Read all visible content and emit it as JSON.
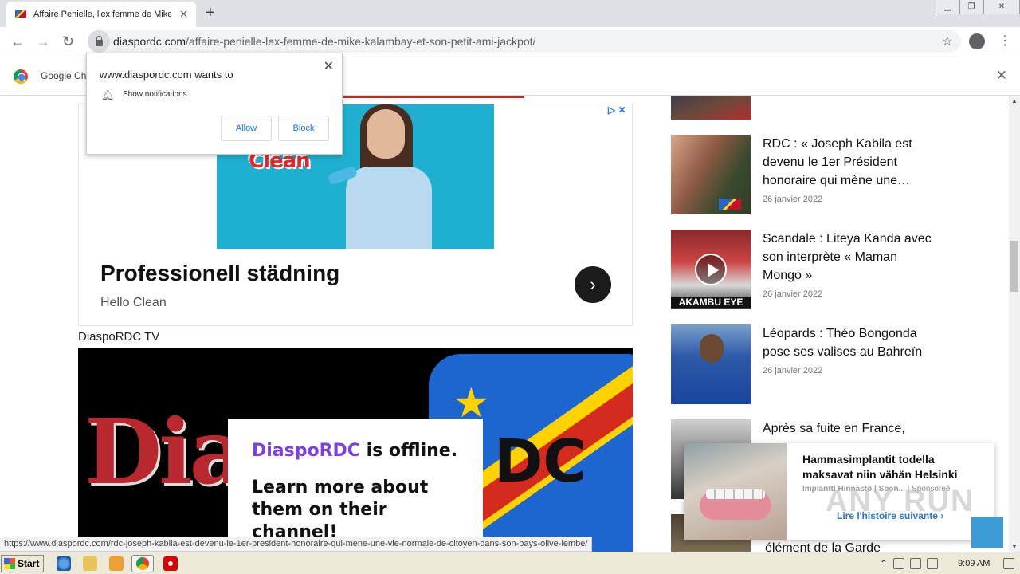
{
  "browser": {
    "tab_title": "Affaire Penielle, l'ex femme de Mike K",
    "url_domain": "diaspordc.com",
    "url_path": "/affaire-penielle-lex-femme-de-mike-kalambay-et-son-petit-ami-jackpot/",
    "infobar_text": "Google Ch"
  },
  "notification": {
    "origin": "www.diaspordc.com wants to",
    "message": "Show notifications",
    "allow_label": "Allow",
    "block_label": "Block"
  },
  "ad": {
    "brand_text": "Clean",
    "headline": "Professionell städning",
    "advertiser": "Hello Clean"
  },
  "video": {
    "section_label": "DiaspoRDC TV",
    "brand_word": "Dia",
    "brand_tail": "DC",
    "offline_brand": "DiaspoRDC",
    "offline_suffix": " is offline.",
    "learn_more": "Learn more about them on their channel!"
  },
  "sidebar": {
    "articles": [
      {
        "title": "RDC : « Joseph Kabila est devenu le 1er Président honoraire qui mène une…",
        "date": "26 janvier 2022"
      },
      {
        "title": "Scandale : Liteya Kanda avec son interprète « Maman Mongo »",
        "date": "26 janvier 2022",
        "thumb_caption": "AKAMBU EYE"
      },
      {
        "title": "Léopards : Théo Bongonda pose ses valises au Bahreïn",
        "date": "26 janvier 2022"
      },
      {
        "title": "Après sa fuite en France,"
      }
    ],
    "bottom_title": "élément de la Garde"
  },
  "sponsored": {
    "title": "Hammasimplantit todella maksavat niin vähän Helsinki",
    "source": "Implantti Hinnasto | Spon...",
    "sponsored_label": "| Sponsoreé",
    "cta": "Lire l'histoire suivante ›"
  },
  "watermark": "ANY RUN",
  "status_url": "https://www.diaspordc.com/rdc-joseph-kabila-est-devenu-le-1er-president-honoraire-qui-mene-une-vie-normale-de-citoyen-dans-son-pays-olive-lembe/",
  "taskbar": {
    "start_label": "Start",
    "clock": "9:09 AM"
  },
  "colors": {
    "offline_brand": "#7b3fe4",
    "cta": "#2a78c8",
    "ad_choices": "#1a73e8"
  }
}
